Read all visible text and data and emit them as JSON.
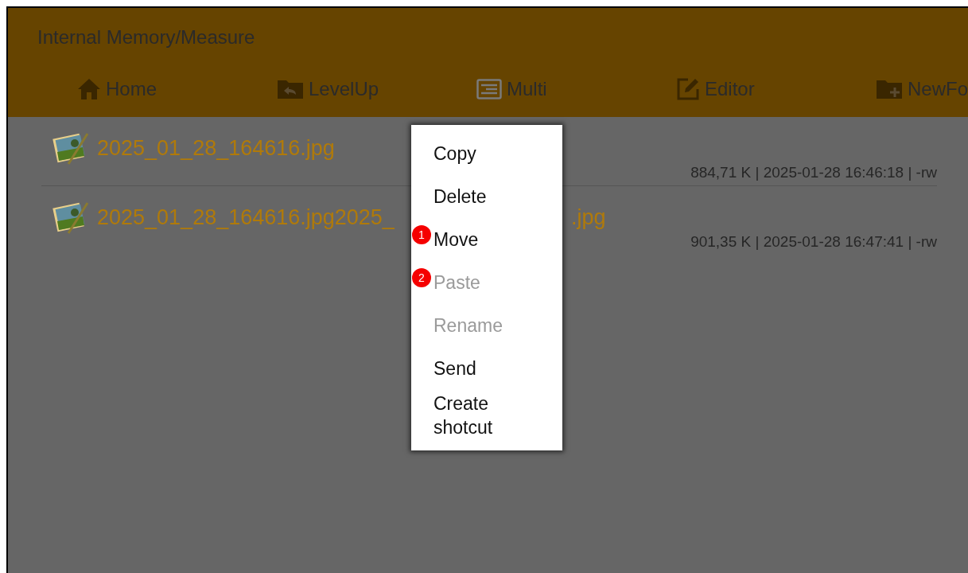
{
  "header": {
    "title": "Internal Memory/Measure"
  },
  "toolbar": [
    {
      "kind": "home",
      "label": "Home"
    },
    {
      "kind": "levelup",
      "label": "LevelUp"
    },
    {
      "kind": "multi",
      "label": "Multi"
    },
    {
      "kind": "editor",
      "label": "Editor"
    },
    {
      "kind": "newfolder",
      "label": "NewFo"
    }
  ],
  "files": [
    {
      "name": "2025_01_28_164616.jpg",
      "meta": "884,71 K | 2025-01-28 16:46:18 | -rw"
    },
    {
      "name": "2025_01_28_164616.jpg2025_",
      "name_end": ".jpg",
      "meta": "901,35 K | 2025-01-28 16:47:41 | -rw"
    }
  ],
  "context_menu": [
    {
      "label": "Copy",
      "disabled": false
    },
    {
      "label": "Delete",
      "disabled": false
    },
    {
      "label": "Move",
      "disabled": false,
      "badge": "1"
    },
    {
      "label": "Paste",
      "disabled": true,
      "badge": "2"
    },
    {
      "label": "Rename",
      "disabled": true
    },
    {
      "label": "Send",
      "disabled": false
    },
    {
      "label": "Create shotcut",
      "disabled": false
    }
  ]
}
